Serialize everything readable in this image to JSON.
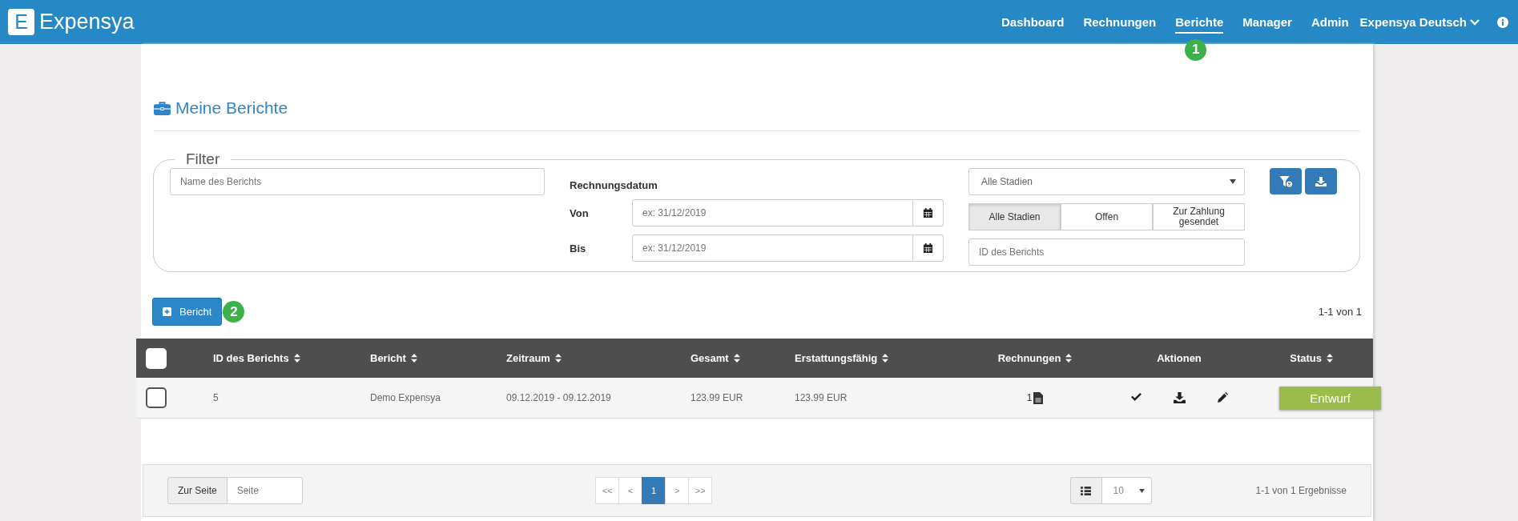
{
  "nav": {
    "logo_letter": "E",
    "logo": "Expensya",
    "items": [
      {
        "label": "Dashboard",
        "selected": false
      },
      {
        "label": "Rechnungen",
        "selected": false
      },
      {
        "label": "Berichte",
        "selected": true
      },
      {
        "label": "Manager",
        "selected": false
      },
      {
        "label": "Admin",
        "selected": false
      }
    ],
    "language": "Expensya Deutsch"
  },
  "markers": [
    {
      "label": "1"
    },
    {
      "label": "2"
    }
  ],
  "page_title": "Meine Berichte",
  "filter": {
    "legend": "Filter",
    "name_field": {
      "placeholder": "Name des Berichts"
    },
    "date_label": "Rechnungsdatum",
    "from_label": "Von",
    "from_field": {
      "placeholder": "ex: 31/12/2019"
    },
    "to_label": "Bis",
    "to_field": {
      "placeholder": "ex: 31/12/2019"
    },
    "status_select": {
      "value": "Alle Stadien"
    },
    "status_tabs": [
      {
        "label": "Alle Stadien",
        "selected": true
      },
      {
        "label": "Offen",
        "selected": false
      },
      {
        "label": "Zur Zahlung gesendet",
        "selected": false
      }
    ],
    "id_field": {
      "placeholder": "ID des Berichts"
    }
  },
  "add_button": "Bericht",
  "range_count": "1-1 von 1",
  "table": {
    "header_checked": false,
    "columns": [
      {
        "label": "ID des Berichts",
        "sortable": true
      },
      {
        "label": "Bericht",
        "sortable": true
      },
      {
        "label": "Zeitraum",
        "sortable": true
      },
      {
        "label": "Gesamt",
        "sortable": true
      },
      {
        "label": "Erstattungsfähig",
        "sortable": true
      },
      {
        "label": "Rechnungen",
        "sortable": true
      },
      {
        "label": "Aktionen",
        "sortable": false
      },
      {
        "label": "Status",
        "sortable": true
      }
    ],
    "rows": [
      {
        "checked": false,
        "cells": [
          "5",
          "Demo Expensya",
          "09.12.2019 - 09.12.2019",
          "123.99 EUR",
          "123.99 EUR"
        ],
        "invoices": "1",
        "status": "Entwurf"
      }
    ]
  },
  "footer": {
    "goto_label": "Zur Seite",
    "goto_field": {
      "placeholder": "Seite"
    },
    "pages": [
      {
        "label": "<<",
        "selected": false
      },
      {
        "label": "<",
        "selected": false
      },
      {
        "label": "1",
        "selected": true
      },
      {
        "label": ">",
        "selected": false
      },
      {
        "label": ">>",
        "selected": false
      }
    ],
    "page_size": "10",
    "results": "1-1 von 1 Ergebnisse"
  }
}
